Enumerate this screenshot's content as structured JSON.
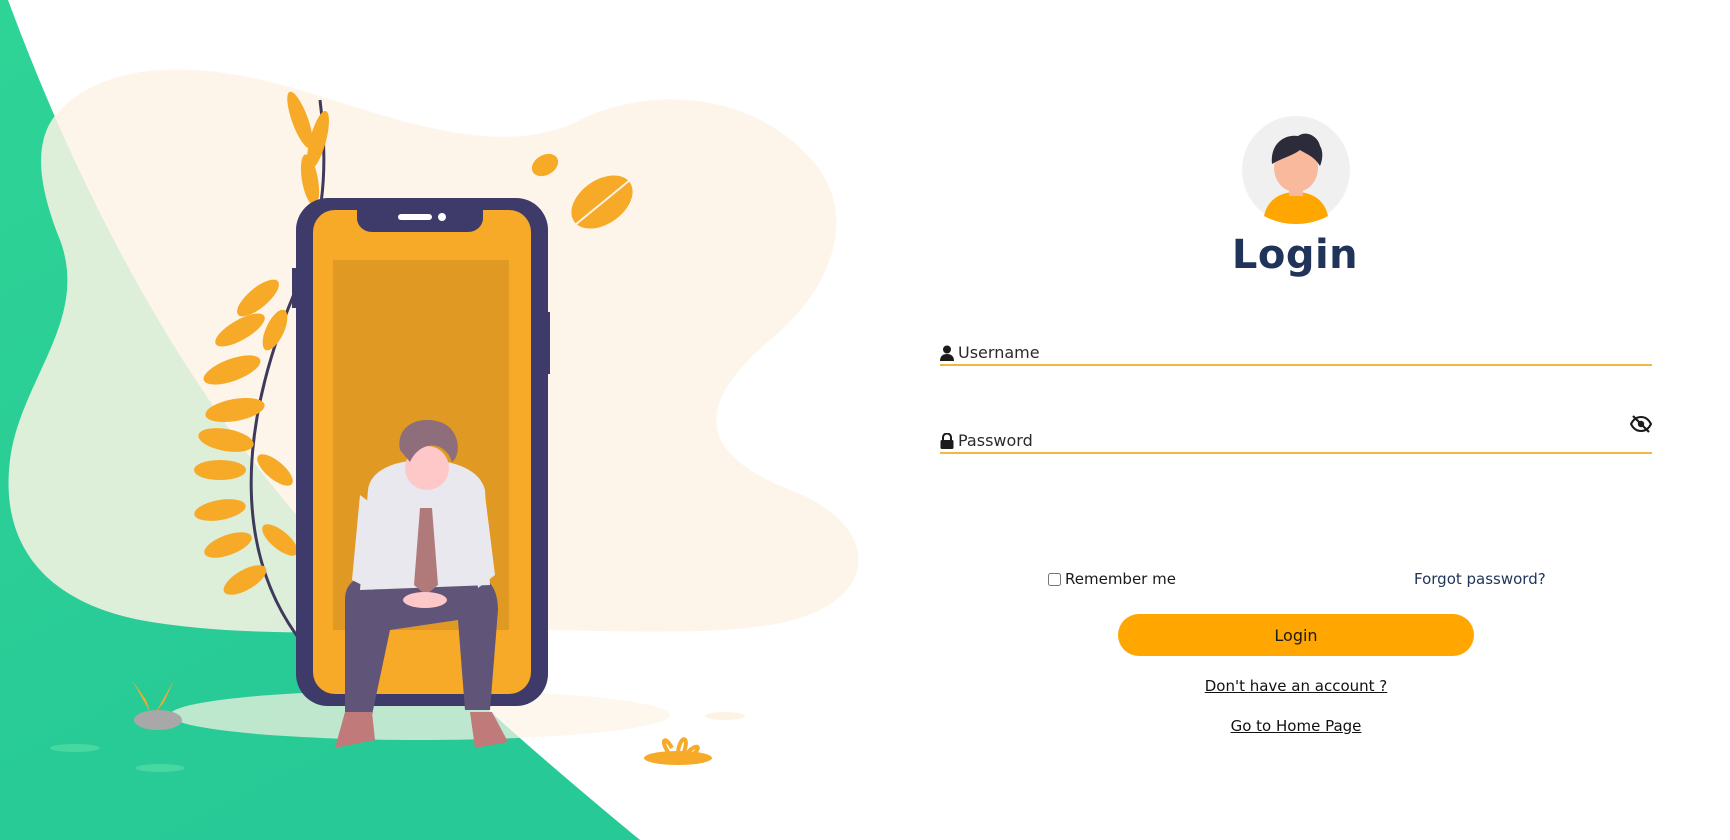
{
  "colors": {
    "accent": "#ffa600",
    "heading": "#1f3458",
    "green": "#2fd197",
    "field_underline": "#f4b63f"
  },
  "form": {
    "title": "Login",
    "username": {
      "label": "Username",
      "icon": "user-icon"
    },
    "password": {
      "label": "Password",
      "icon": "lock-icon",
      "toggle_icon": "eye-slash-icon"
    },
    "remember_label": "Remember me",
    "forgot_label": "Forgot password?",
    "submit_label": "Login",
    "signup_link": "Don't have an account ?",
    "home_link": "Go to Home Page"
  }
}
